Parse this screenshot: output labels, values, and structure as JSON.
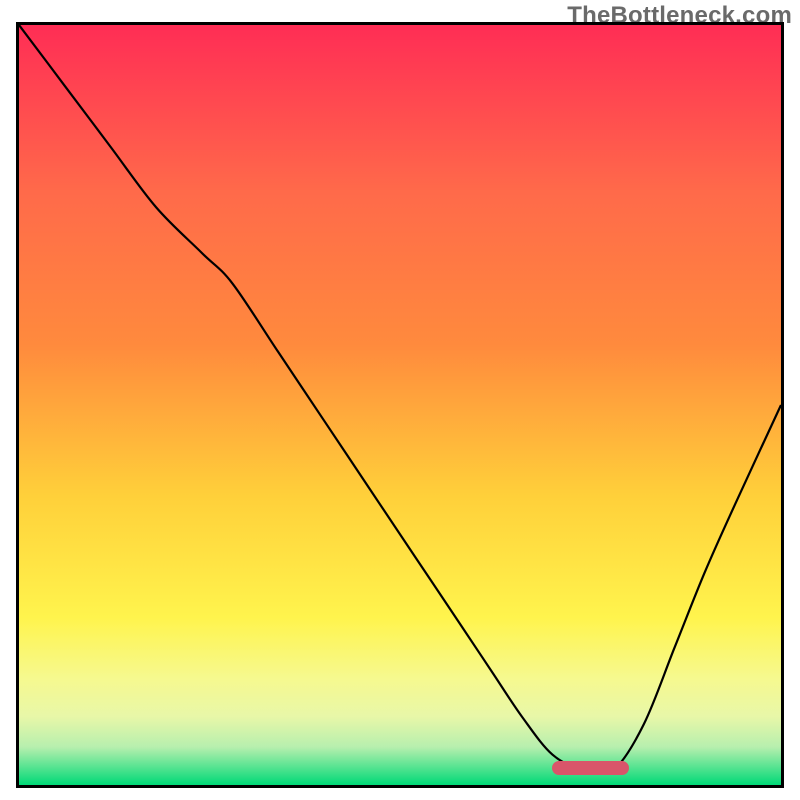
{
  "watermark": "TheBottleneck.com",
  "chart_data": {
    "type": "line",
    "title": "",
    "xlabel": "",
    "ylabel": "",
    "xlim": [
      0,
      1
    ],
    "ylim": [
      0,
      1
    ],
    "x": [
      0.0,
      0.06,
      0.12,
      0.18,
      0.24,
      0.28,
      0.34,
      0.4,
      0.46,
      0.52,
      0.58,
      0.62,
      0.66,
      0.7,
      0.74,
      0.78,
      0.82,
      0.86,
      0.9,
      0.94,
      1.0
    ],
    "values": [
      1.0,
      0.92,
      0.84,
      0.76,
      0.7,
      0.66,
      0.57,
      0.48,
      0.39,
      0.3,
      0.21,
      0.15,
      0.09,
      0.04,
      0.02,
      0.02,
      0.08,
      0.18,
      0.28,
      0.37,
      0.5
    ],
    "annotations": [
      {
        "type": "marker",
        "x_start": 0.7,
        "x_end": 0.8,
        "y": 0.022,
        "color": "#d9556a"
      }
    ],
    "background_gradient": {
      "top": "#ff2d55",
      "mid_top": "#ff8a3d",
      "mid": "#ffd03a",
      "mid_low_a": "#fff44d",
      "mid_low_b": "#f6f98f",
      "low_a": "#e8f7a8",
      "low_b": "#b7efae",
      "bottom": "#00d977"
    },
    "grid": false,
    "legend": null
  }
}
